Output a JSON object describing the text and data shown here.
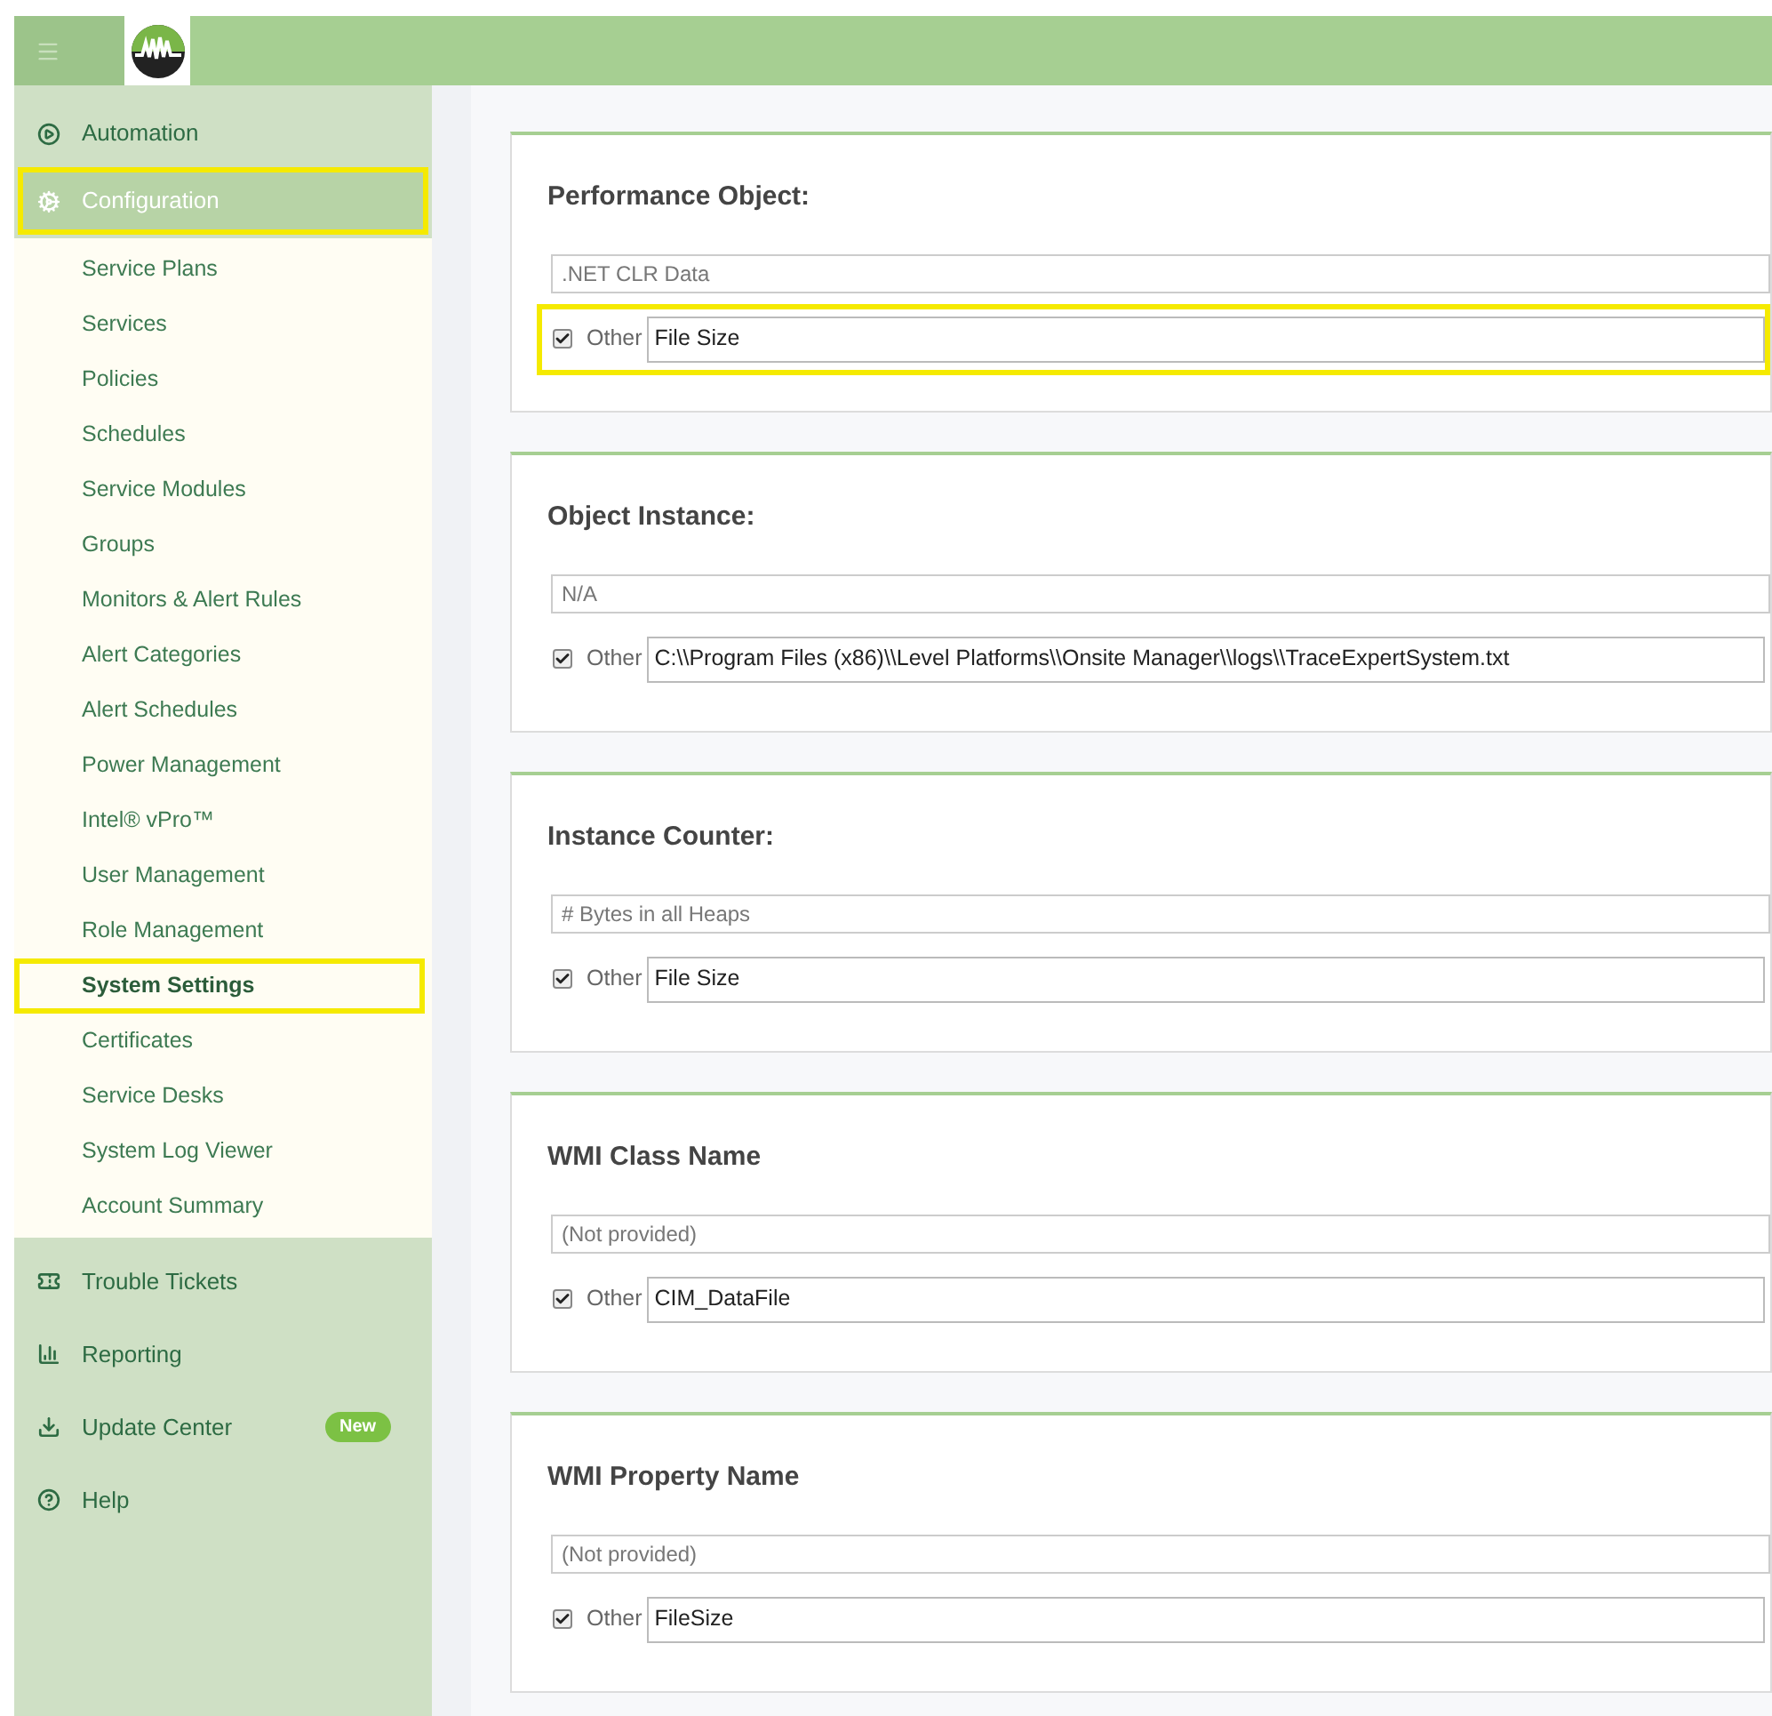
{
  "sidebar": {
    "top_items": [
      {
        "label": "Automation",
        "highlighted": false,
        "expanded": false
      },
      {
        "label": "Configuration",
        "highlighted": true,
        "expanded": true
      }
    ],
    "submenu": [
      {
        "label": "Service Plans",
        "selected": false,
        "highlighted": false
      },
      {
        "label": "Services",
        "selected": false,
        "highlighted": false
      },
      {
        "label": "Policies",
        "selected": false,
        "highlighted": false
      },
      {
        "label": "Schedules",
        "selected": false,
        "highlighted": false
      },
      {
        "label": "Service Modules",
        "selected": false,
        "highlighted": false
      },
      {
        "label": "Groups",
        "selected": false,
        "highlighted": false
      },
      {
        "label": "Monitors & Alert Rules",
        "selected": false,
        "highlighted": false
      },
      {
        "label": "Alert Categories",
        "selected": false,
        "highlighted": false
      },
      {
        "label": "Alert Schedules",
        "selected": false,
        "highlighted": false
      },
      {
        "label": "Power Management",
        "selected": false,
        "highlighted": false
      },
      {
        "label": "Intel® vPro™",
        "selected": false,
        "highlighted": false
      },
      {
        "label": "User Management",
        "selected": false,
        "highlighted": false
      },
      {
        "label": "Role Management",
        "selected": false,
        "highlighted": false
      },
      {
        "label": "System Settings",
        "selected": true,
        "highlighted": true
      },
      {
        "label": "Certificates",
        "selected": false,
        "highlighted": false
      },
      {
        "label": "Service Desks",
        "selected": false,
        "highlighted": false
      },
      {
        "label": "System Log Viewer",
        "selected": false,
        "highlighted": false
      },
      {
        "label": "Account Summary",
        "selected": false,
        "highlighted": false
      }
    ],
    "bottom_items": [
      {
        "label": "Trouble Tickets"
      },
      {
        "label": "Reporting"
      },
      {
        "label": "Update Center",
        "badge": "New"
      },
      {
        "label": "Help"
      }
    ]
  },
  "cards": [
    {
      "title": "Performance Object:",
      "select_value": ".NET CLR Data",
      "other_label": "Other",
      "other_checked": true,
      "other_value": "File Size",
      "highlighted": true
    },
    {
      "title": "Object Instance:",
      "select_value": "N/A",
      "other_label": "Other",
      "other_checked": true,
      "other_value": "C:\\\\Program Files (x86)\\\\Level Platforms\\\\Onsite Manager\\\\logs\\\\TraceExpertSystem.txt",
      "highlighted": false
    },
    {
      "title": "Instance Counter:",
      "select_value": "# Bytes in all Heaps",
      "other_label": "Other",
      "other_checked": true,
      "other_value": "File Size",
      "highlighted": false
    },
    {
      "title": "WMI Class Name",
      "select_value": "(Not provided)",
      "other_label": "Other",
      "other_checked": true,
      "other_value": "CIM_DataFile",
      "highlighted": false
    },
    {
      "title": "WMI Property Name",
      "select_value": "(Not provided)",
      "other_label": "Other",
      "other_checked": true,
      "other_value": "FileSize",
      "highlighted": false
    }
  ]
}
